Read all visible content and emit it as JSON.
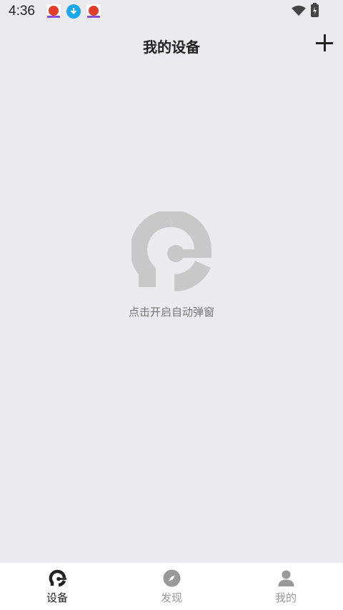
{
  "status_bar": {
    "time": "4:36"
  },
  "header": {
    "title": "我的设备"
  },
  "empty_state": {
    "message": "点击开启自动弹窗"
  },
  "bottom_nav": {
    "tabs": [
      {
        "label": "设备",
        "icon": "device-icon",
        "active": true
      },
      {
        "label": "发现",
        "icon": "compass-icon",
        "active": false
      },
      {
        "label": "我的",
        "icon": "person-icon",
        "active": false
      }
    ]
  },
  "colors": {
    "background": "#ebebef",
    "logo_gray": "#c8c8c8",
    "active_text": "#222222",
    "inactive_text": "#999999"
  }
}
